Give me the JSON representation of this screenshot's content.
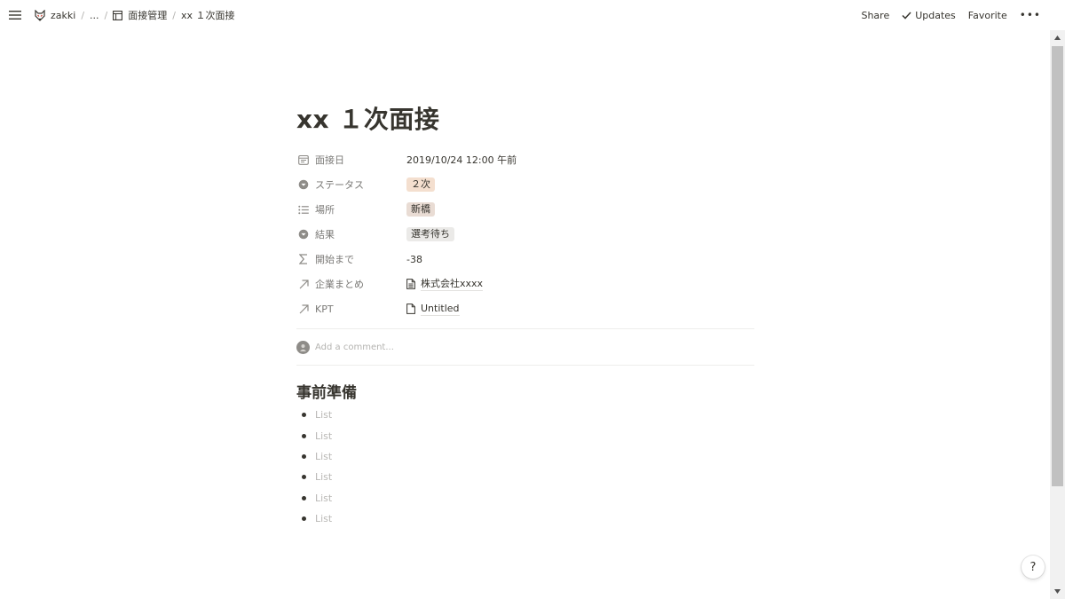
{
  "topbar": {
    "workspace": "zakki",
    "ellipsis": "...",
    "separator": "/",
    "database": "面接管理",
    "current_page": "xx １次面接",
    "share_label": "Share",
    "updates_label": "Updates",
    "favorite_label": "Favorite",
    "more_label": "•••"
  },
  "page": {
    "title": "xx １次面接",
    "properties": [
      {
        "icon": "calendar-icon",
        "name": "面接日",
        "value": "2019/10/24 12:00 午前",
        "type": "date"
      },
      {
        "icon": "select-icon",
        "name": "ステータス",
        "value": "２次",
        "type": "tag",
        "color": "#f4dfcf"
      },
      {
        "icon": "list-icon",
        "name": "場所",
        "value": "新橋",
        "type": "tag",
        "color": "#e9dcd4"
      },
      {
        "icon": "select-icon",
        "name": "結果",
        "value": "選考待ち",
        "type": "tag",
        "color": "#ebeae8"
      },
      {
        "icon": "sigma-icon",
        "name": "開始まで",
        "value": "-38",
        "type": "formula"
      },
      {
        "icon": "arrow-up-right-icon",
        "name": "企業まとめ",
        "value": "株式会社xxxx",
        "type": "relation",
        "page_icon": "document-text-icon"
      },
      {
        "icon": "arrow-up-right-icon",
        "name": "KPT",
        "value": "Untitled",
        "type": "relation",
        "page_icon": "document-icon"
      }
    ],
    "comment_placeholder": "Add a comment...",
    "section_heading": "事前準備",
    "bullets": [
      "List",
      "List",
      "List",
      "List",
      "List",
      "List"
    ]
  },
  "help": {
    "label": "?"
  },
  "colors": {
    "text": "#37352f",
    "muted": "#7b7a77",
    "placeholder": "#b4b3b0"
  }
}
